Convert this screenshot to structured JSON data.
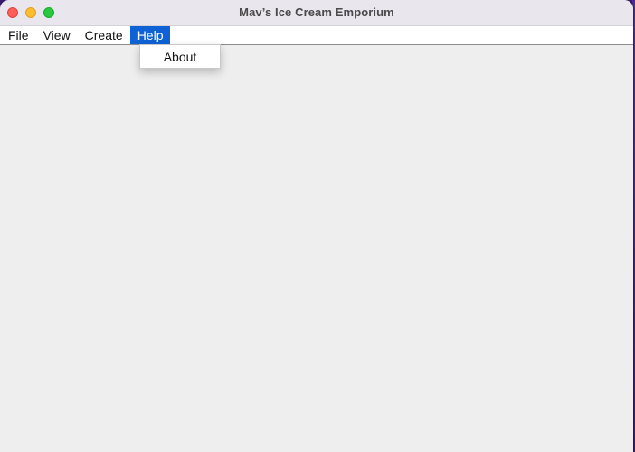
{
  "window": {
    "title": "Mav’s Ice Cream Emporium"
  },
  "menubar": {
    "items": [
      {
        "label": "File"
      },
      {
        "label": "View"
      },
      {
        "label": "Create"
      },
      {
        "label": "Help",
        "active": true
      }
    ]
  },
  "help_menu": {
    "items": [
      {
        "label": "About"
      }
    ]
  },
  "colors": {
    "menu_highlight": "#0f62d6",
    "close": "#fe5f57",
    "minimize": "#febc2e",
    "maximize": "#28c840"
  }
}
